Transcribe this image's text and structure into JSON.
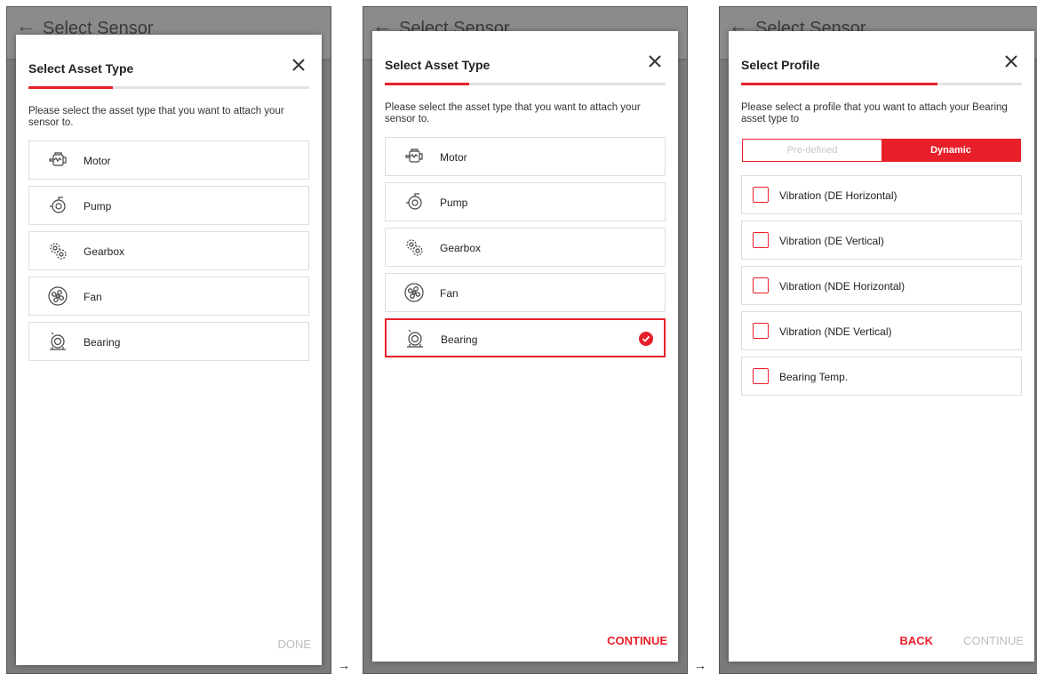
{
  "screens": [
    {
      "appbar_title": "Select Sensor",
      "dialog_title": "Select Asset Type",
      "progress": 0.3,
      "instruction": "Please select the asset type that you want to attach your sensor to.",
      "items": [
        {
          "label": "Motor",
          "icon": "motor-icon"
        },
        {
          "label": "Pump",
          "icon": "pump-icon"
        },
        {
          "label": "Gearbox",
          "icon": "gearbox-icon"
        },
        {
          "label": "Fan",
          "icon": "fan-icon"
        },
        {
          "label": "Bearing",
          "icon": "bearing-icon"
        }
      ],
      "footer": {
        "done_label": "DONE"
      }
    },
    {
      "appbar_title": "Select Sensor",
      "dialog_title": "Select Asset Type",
      "progress": 0.3,
      "instruction": "Please select the asset type that you want to attach your sensor to.",
      "items": [
        {
          "label": "Motor",
          "icon": "motor-icon"
        },
        {
          "label": "Pump",
          "icon": "pump-icon"
        },
        {
          "label": "Gearbox",
          "icon": "gearbox-icon"
        },
        {
          "label": "Fan",
          "icon": "fan-icon"
        },
        {
          "label": "Bearing",
          "icon": "bearing-icon",
          "selected": true
        }
      ],
      "footer": {
        "continue_label": "CONTINUE"
      }
    },
    {
      "appbar_title": "Select Sensor",
      "dialog_title": "Select Profile",
      "progress": 0.7,
      "instruction": "Please select a profile that you want to attach your Bearing asset type to",
      "toggle": {
        "predefined_label": "Pre-defined",
        "dynamic_label": "Dynamic",
        "active": "Dynamic"
      },
      "profiles": [
        "Vibration (DE Horizontal)",
        "Vibration (DE Vertical)",
        "Vibration (NDE Horizontal)",
        "Vibration (NDE Vertical)",
        "Bearing Temp."
      ],
      "footer": {
        "back_label": "BACK",
        "continue_label": "CONTINUE"
      }
    }
  ],
  "arrow_glyph": "→",
  "colors": {
    "accent": "#e8202a",
    "disabled": "#bdbdbd",
    "overlay": "#7a7a7a"
  }
}
